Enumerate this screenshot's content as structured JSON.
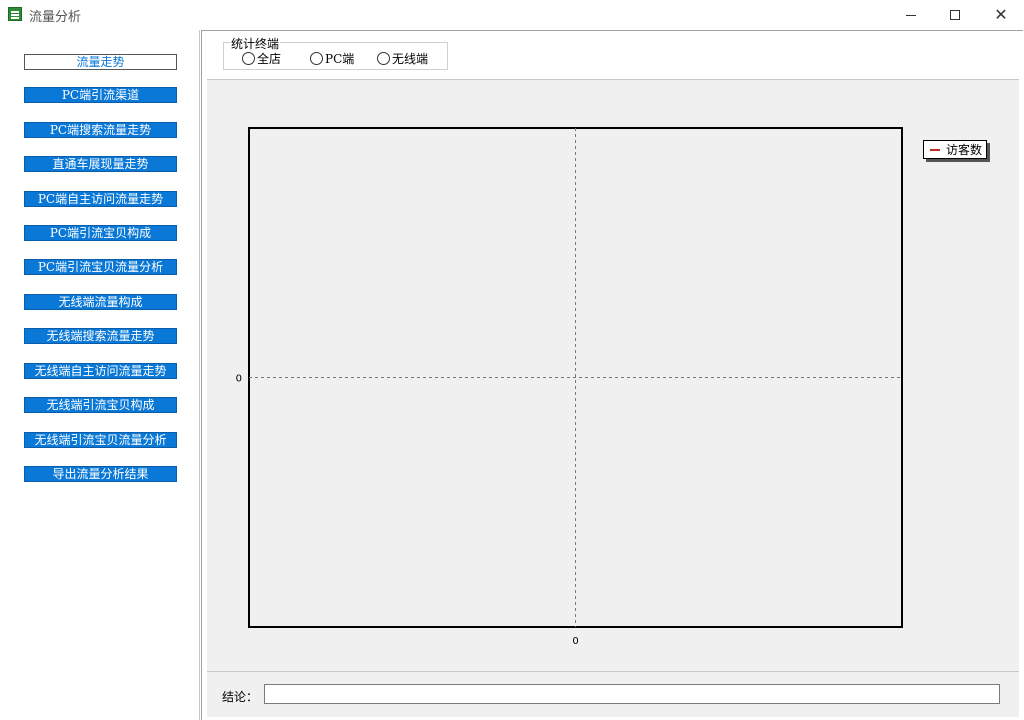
{
  "window": {
    "title": "流量分析",
    "icon": "spreadsheet-icon",
    "controls": {
      "minimize": "minimize-icon",
      "maximize": "maximize-icon",
      "close": "close-icon"
    }
  },
  "sidebar": {
    "items": [
      {
        "label": "流量走势",
        "active": true
      },
      {
        "label": "PC端引流渠道",
        "active": false
      },
      {
        "label": "PC端搜索流量走势",
        "active": false
      },
      {
        "label": "直通车展现量走势",
        "active": false
      },
      {
        "label": "PC端自主访问流量走势",
        "active": false
      },
      {
        "label": "PC端引流宝贝构成",
        "active": false
      },
      {
        "label": "PC端引流宝贝流量分析",
        "active": false
      },
      {
        "label": "无线端流量构成",
        "active": false
      },
      {
        "label": "无线端搜索流量走势",
        "active": false
      },
      {
        "label": "无线端自主访问流量走势",
        "active": false
      },
      {
        "label": "无线端引流宝贝构成",
        "active": false
      },
      {
        "label": "无线端引流宝贝流量分析",
        "active": false
      },
      {
        "label": "导出流量分析结果",
        "active": false
      }
    ],
    "colors": {
      "button_bg": "#0a78d7",
      "button_text": "#ffffff"
    }
  },
  "filter": {
    "legend": "统计终端",
    "options": [
      {
        "label": "全店",
        "checked": false
      },
      {
        "label": "PC端",
        "checked": false
      },
      {
        "label": "无线端",
        "checked": false
      }
    ]
  },
  "chart_data": {
    "type": "line",
    "title": "",
    "xlabel": "",
    "ylabel": "",
    "x_ticks": [
      "0"
    ],
    "y_ticks": [
      "0"
    ],
    "series": [
      {
        "name": "访客数",
        "color": "#c62828",
        "values": []
      }
    ],
    "legend_position": "top-right",
    "grid": true
  },
  "conclusion": {
    "label": "结论：",
    "value": ""
  }
}
